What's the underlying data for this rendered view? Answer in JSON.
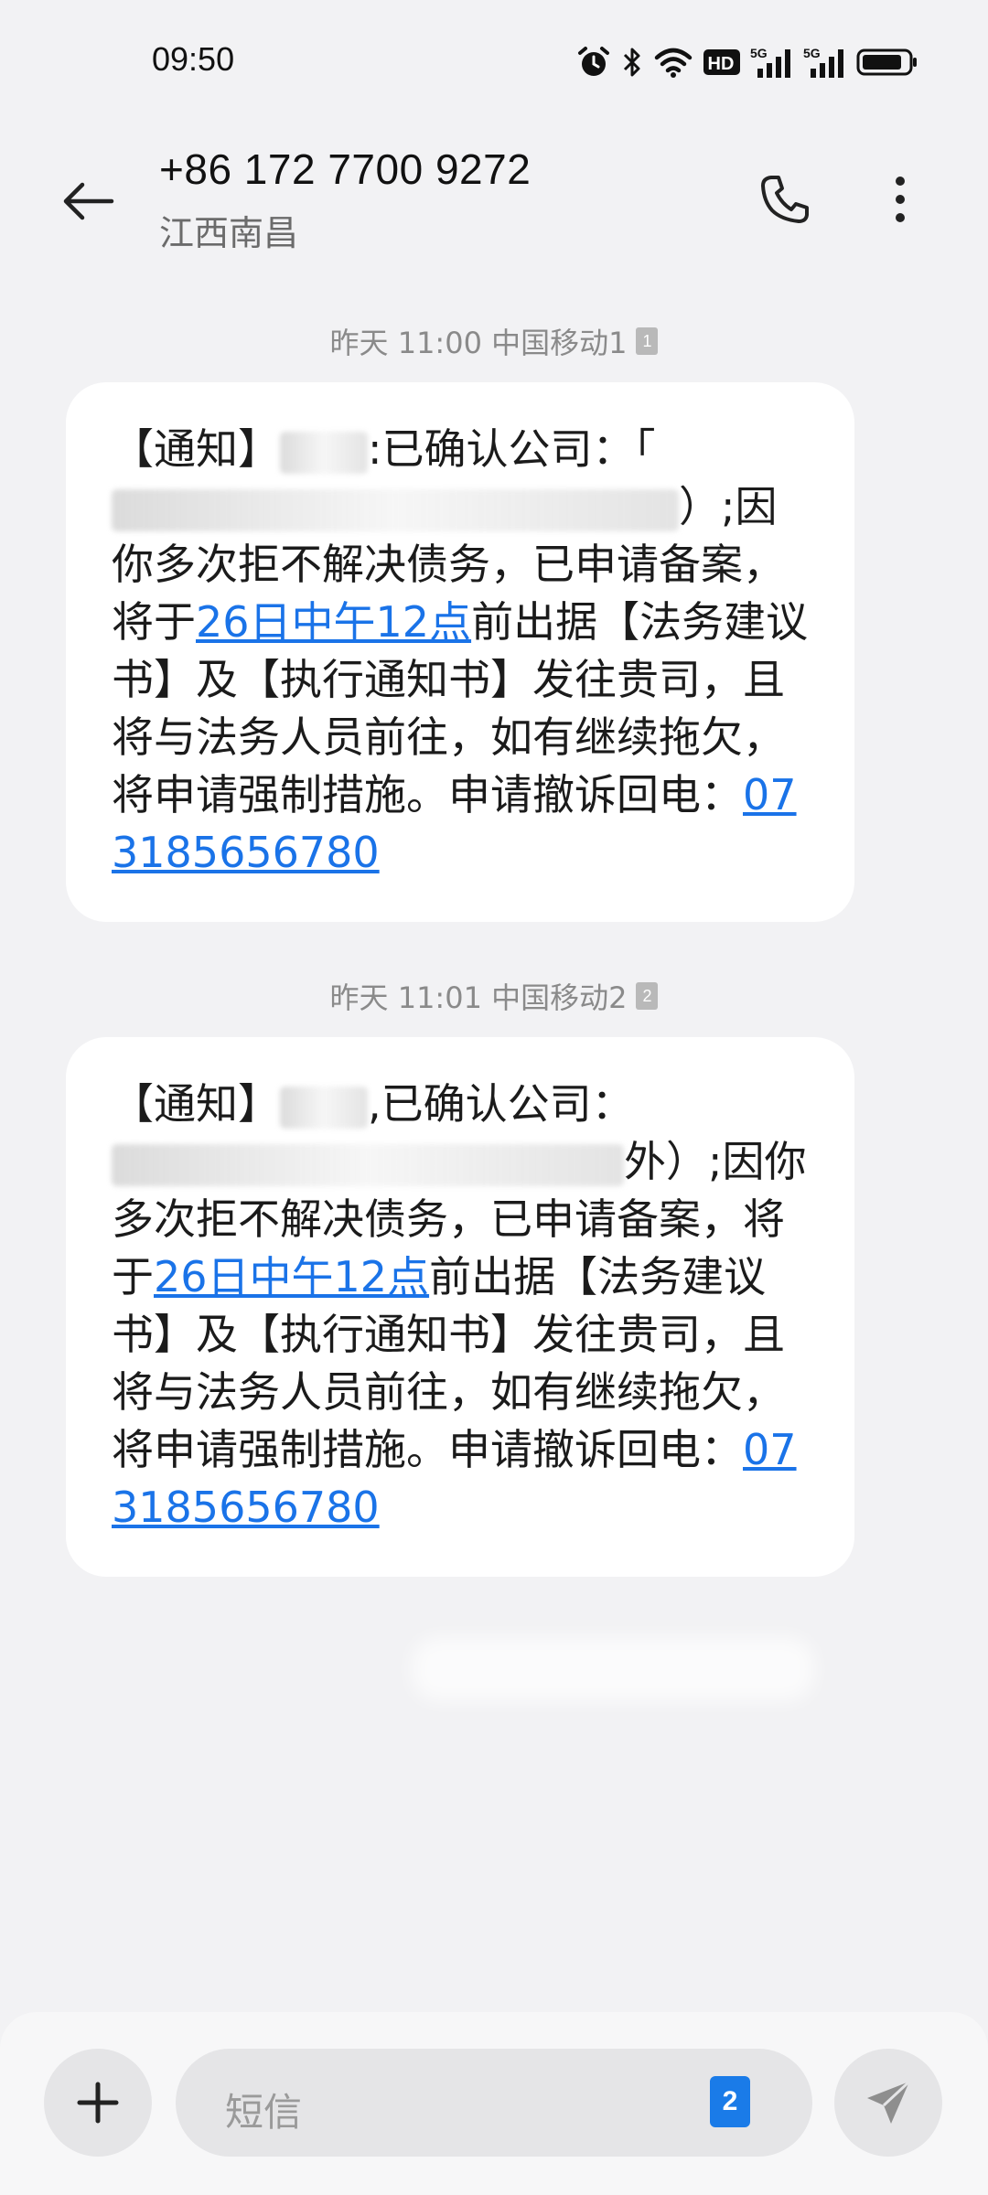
{
  "status_bar": {
    "time": "09:50",
    "icons": [
      "alarm-icon",
      "bluetooth-icon",
      "wifi-icon",
      "hd-icon",
      "5g-signal-icon",
      "5g-signal-icon",
      "battery-icon"
    ],
    "hd_label": "HD",
    "network_1": "5G",
    "network_2": "5G"
  },
  "header": {
    "contact_number": "+86 172 7700 9272",
    "location": "江西南昌"
  },
  "messages": [
    {
      "meta": "昨天 11:00 中国移动1",
      "sim": "1",
      "pre": "【通知】",
      "confirm": ":已确认公司：「",
      "after_redact": "）;因你多次拒不解决债务，已申请备案，将于",
      "link_date": "26日中午12点",
      "mid": "前出据【法务建议书】及【执行通知书】发往贵司，且将与法务人员前往，如有继续拖欠，将申请强制措施。申请撤诉回电：",
      "link_phone": "073185656780"
    },
    {
      "meta": "昨天 11:01 中国移动2",
      "sim": "2",
      "pre": "【通知】",
      "confirm": ",已确认公司：",
      "after_redact": "外）;因你多次拒不解决债务，已申请备案，将于",
      "link_date": "26日中午12点",
      "mid": "前出据【法务建议书】及【执行通知书】发往贵司，且将与法务人员前往，如有继续拖欠，将申请强制措施。申请撤诉回电：",
      "link_phone": "073185656780"
    }
  ],
  "composer": {
    "placeholder": "短信",
    "sim_selected": "2"
  },
  "colors": {
    "background": "#f2f2f4",
    "bubble": "#ffffff",
    "link": "#1a73e8",
    "sim_badge": "#1a7be8"
  }
}
